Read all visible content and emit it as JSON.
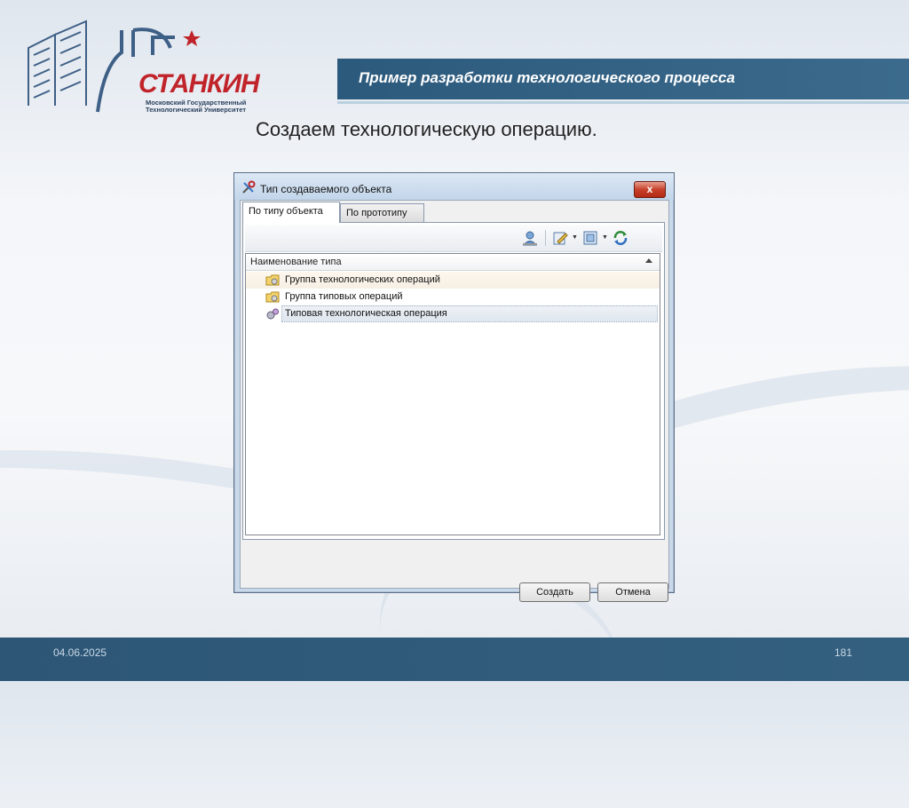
{
  "header": {
    "title": "Пример разработки технологического процесса"
  },
  "logo": {
    "name": "СТАНКИН",
    "sub_line1": "Московский Государственный",
    "sub_line2": "Технологический Университет"
  },
  "slide": {
    "subtitle": "Создаем технологическую операцию."
  },
  "dialog": {
    "title": "Тип создаваемого объекта",
    "close_glyph": "x",
    "tabs": [
      {
        "label": "По типу объекта"
      },
      {
        "label": "По прототипу"
      }
    ],
    "toolbar_icons": [
      "user-icon",
      "edit-icon",
      "view-icon",
      "refresh-icon"
    ],
    "list": {
      "column_header": "Наименование типа",
      "rows": [
        {
          "label": "Группа технологических операций",
          "icon": "folder-group-icon"
        },
        {
          "label": "Группа типовых операций",
          "icon": "folder-group-icon"
        },
        {
          "label": "Типовая технологическая операция",
          "icon": "gears-icon"
        }
      ]
    },
    "buttons": {
      "create": "Создать",
      "cancel": "Отмена"
    }
  },
  "footer": {
    "date": "04.06.2025",
    "page": "181"
  },
  "colors": {
    "band": "#2c5a7c",
    "logo_red": "#c0242a",
    "close_red": "#c7402a"
  }
}
